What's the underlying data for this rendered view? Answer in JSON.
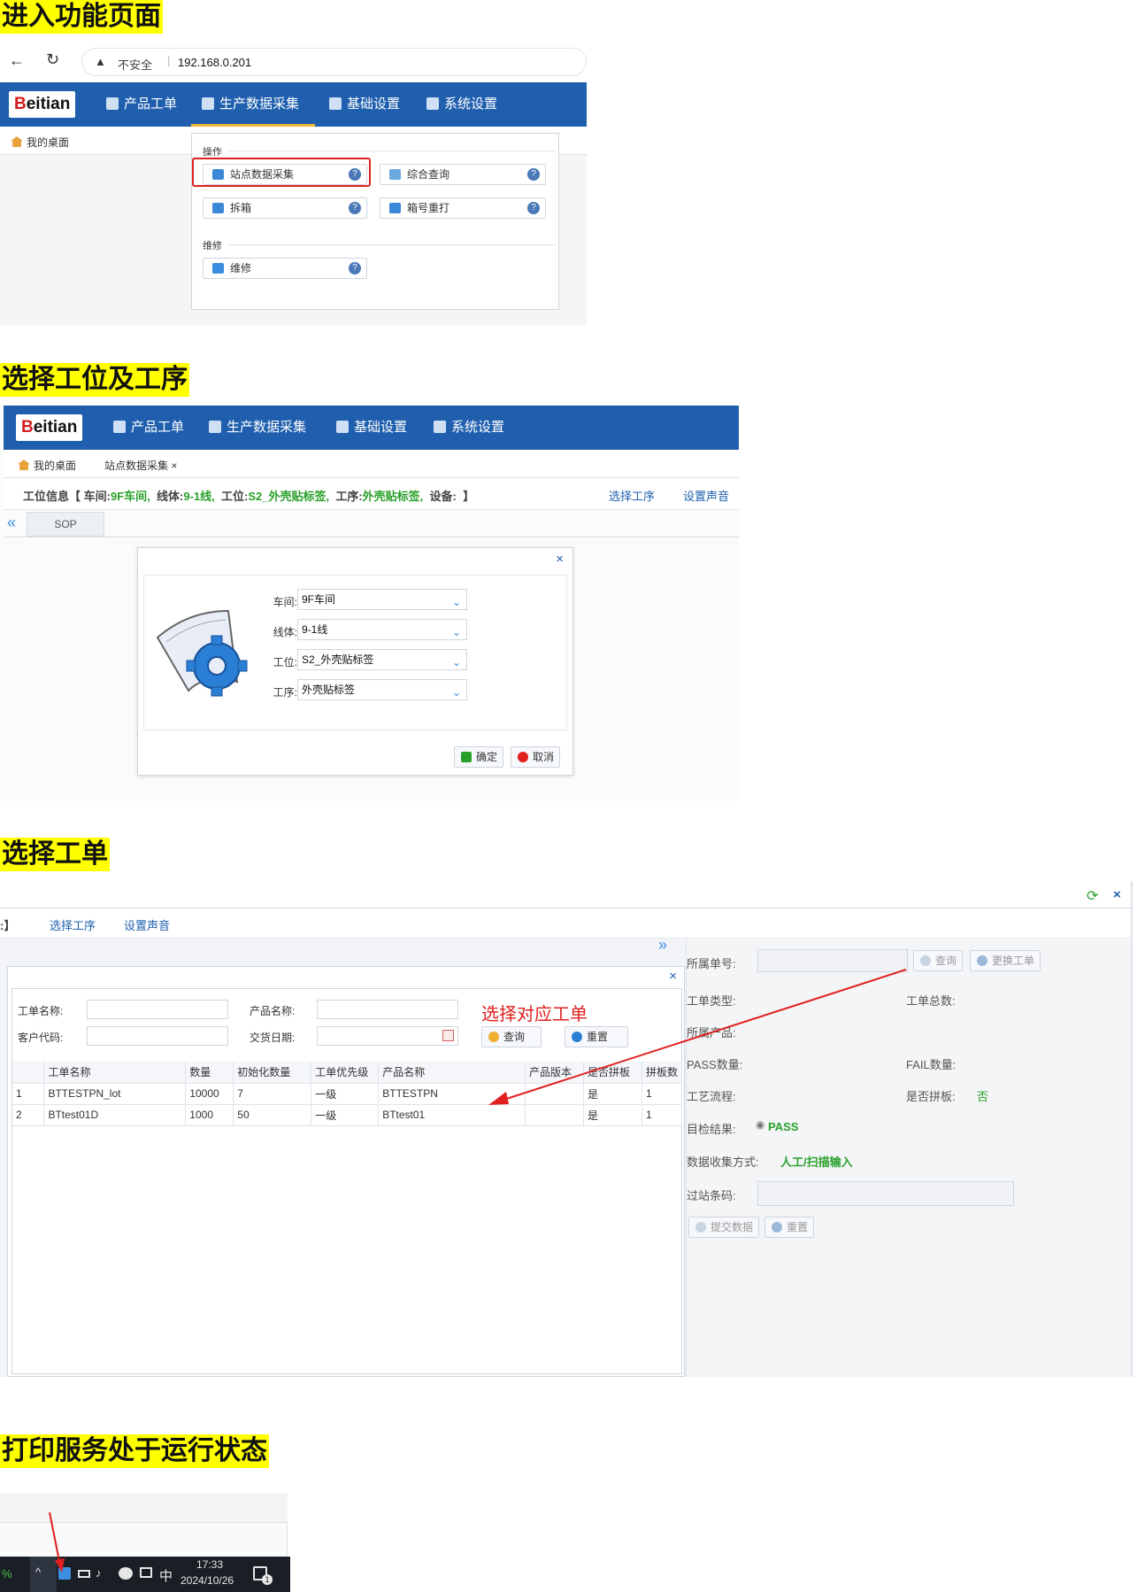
{
  "headings": {
    "h1": "进入功能页面",
    "h2": "选择工位及工序",
    "h3": "选择工单",
    "h4": "打印服务处于运行状态"
  },
  "browser": {
    "not_secure": "不安全",
    "address": "192.168.0.201"
  },
  "app": {
    "logo_b": "B",
    "logo_rest": "eitian",
    "nav": [
      "产品工单",
      "生产数据采集",
      "基础设置",
      "系统设置"
    ],
    "home_tab": "我的桌面"
  },
  "menu": {
    "section_ops": "操作",
    "items": [
      {
        "label": "站点数据采集"
      },
      {
        "label": "综合查询"
      },
      {
        "label": "拆箱"
      },
      {
        "label": "箱号重打"
      }
    ],
    "section_repair": "维修",
    "repair": "维修"
  },
  "station": {
    "tab_active": "站点数据采集 ×",
    "info_prefix": "工位信息【",
    "workshop_label": "车间:",
    "workshop": "9F车间,",
    "line_label": "线体:",
    "line": "9-1线,",
    "station_label": "工位:",
    "station": "S2_外壳贴标签,",
    "process_label": "工序:",
    "process": "外壳贴标签,",
    "device_label": "设备:",
    "info_suffix": "】",
    "choose_process": "选择工序",
    "set_sound": "设置声音",
    "sop_tab": "SOP",
    "collapse": "«"
  },
  "dialog": {
    "close": "×",
    "fields": [
      {
        "label": "车间:",
        "value": "9F车间"
      },
      {
        "label": "线体:",
        "value": "9-1线"
      },
      {
        "label": "工位:",
        "value": "S2_外壳贴标签"
      },
      {
        "label": "工序:",
        "value": "外壳贴标签"
      }
    ],
    "ok": "确定",
    "cancel": "取消"
  },
  "workorder": {
    "info_suffix": ":】",
    "choose_process": "选择工序",
    "set_sound": "设置声音",
    "expand": "»",
    "close": "×",
    "annotation": "选择对应工单",
    "filter": {
      "name_label": "工单名称:",
      "product_label": "产品名称:",
      "customer_label": "客户代码:",
      "date_label": "交货日期:",
      "query": "查询",
      "reset": "重置"
    },
    "columns": [
      "",
      "工单名称",
      "数量",
      "初始化数量",
      "工单优先级",
      "产品名称",
      "产品版本",
      "是否拼板",
      "拼板数"
    ],
    "rows": [
      [
        "1",
        "BTTESTPN_lot",
        "10000",
        "7",
        "一级",
        "BTTESTPN",
        "",
        "是",
        "1"
      ],
      [
        "2",
        "BTtest01D",
        "1000",
        "50",
        "一级",
        "BTtest01",
        "",
        "是",
        "1"
      ]
    ],
    "right": {
      "order_label": "所属单号:",
      "query": "查询",
      "change": "更换工单",
      "type_label": "工单类型:",
      "total_label": "工单总数:",
      "product_label": "所属产品:",
      "pass_label": "PASS数量:",
      "fail_label": "FAIL数量:",
      "flow_label": "工艺流程:",
      "panel_label": "是否拼板:",
      "panel_value": "否",
      "check_label": "目检结果:",
      "check_value": "PASS",
      "collect_label": "数据收集方式:",
      "collect_value": "人工/扫描输入",
      "barcode_label": "过站条码:",
      "submit": "提交数据",
      "reset": "重置"
    }
  },
  "taskbar": {
    "percent": "%",
    "ime": "中",
    "time": "17:33",
    "date": "2024/10/26",
    "notif_count": "1"
  },
  "colors": {
    "nav_blue": "#1f5fae",
    "highlight_yellow": "#ffff00",
    "annotation_red": "#e02020",
    "status_green": "#2aa02a"
  }
}
